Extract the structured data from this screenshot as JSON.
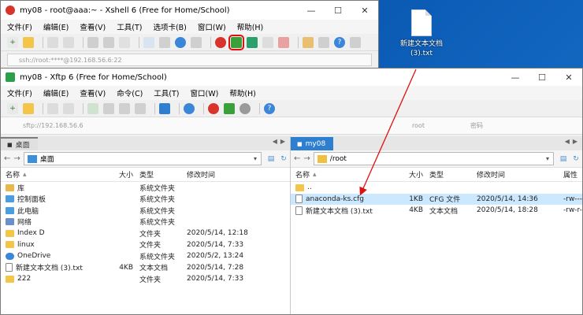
{
  "desktop": {
    "file_label_line1": "新建文本文档",
    "file_label_line2": "(3).txt"
  },
  "xshell": {
    "title": "my08 - root@aaa:~ - Xshell 6 (Free for Home/School)",
    "menus": [
      "文件(F)",
      "编辑(E)",
      "查看(V)",
      "工具(T)",
      "选项卡(B)",
      "窗口(W)",
      "帮助(H)"
    ],
    "address": "ssh://root:****@192.168.56.6:22"
  },
  "xftp": {
    "title": "my08 - Xftp 6 (Free for Home/School)",
    "menus": [
      "文件(F)",
      "编辑(E)",
      "查看(V)",
      "命令(C)",
      "工具(T)",
      "窗口(W)",
      "帮助(H)"
    ],
    "address": "sftp://192.168.56.6",
    "remote_user_placeholder": "root",
    "remote_password_placeholder": "密码"
  },
  "local": {
    "tab": "桌面",
    "path": "桌面",
    "columns": {
      "name": "名称",
      "size": "大小",
      "type": "类型",
      "time": "修改时间"
    },
    "rows": [
      {
        "icon": "lib",
        "name": "库",
        "size": "",
        "type": "系统文件夹",
        "time": ""
      },
      {
        "icon": "pc",
        "name": "控制面板",
        "size": "",
        "type": "系统文件夹",
        "time": ""
      },
      {
        "icon": "pc",
        "name": "此电脑",
        "size": "",
        "type": "系统文件夹",
        "time": ""
      },
      {
        "icon": "net",
        "name": "网络",
        "size": "",
        "type": "系统文件夹",
        "time": ""
      },
      {
        "icon": "folder",
        "name": "Index D",
        "size": "",
        "type": "文件夹",
        "time": "2020/5/14, 12:18"
      },
      {
        "icon": "folder",
        "name": "linux",
        "size": "",
        "type": "文件夹",
        "time": "2020/5/14, 7:33"
      },
      {
        "icon": "cloud",
        "name": "OneDrive",
        "size": "",
        "type": "系统文件夹",
        "time": "2020/5/2, 13:24"
      },
      {
        "icon": "file",
        "name": "新建文本文档 (3).txt",
        "size": "4KB",
        "type": "文本文档",
        "time": "2020/5/14, 7:28"
      },
      {
        "icon": "folder",
        "name": "222",
        "size": "",
        "type": "文件夹",
        "time": "2020/5/14, 7:33"
      }
    ]
  },
  "remote": {
    "tab": "my08",
    "path": "/root",
    "columns": {
      "name": "名称",
      "size": "大小",
      "type": "类型",
      "time": "修改时间",
      "attr": "属性"
    },
    "rows": [
      {
        "icon": "up",
        "name": "..",
        "size": "",
        "type": "",
        "time": "",
        "attr": ""
      },
      {
        "icon": "file",
        "name": "anaconda-ks.cfg",
        "size": "1KB",
        "type": "CFG 文件",
        "time": "2020/5/14, 14:36",
        "attr": "-rw----"
      },
      {
        "icon": "file",
        "name": "新建文本文档 (3).txt",
        "size": "4KB",
        "type": "文本文档",
        "time": "2020/5/14, 18:28",
        "attr": "-rw-r--"
      }
    ]
  },
  "colors": {
    "accent": "#2e7fd0",
    "highlight_red": "#e01010",
    "selection": "#cce8ff"
  }
}
